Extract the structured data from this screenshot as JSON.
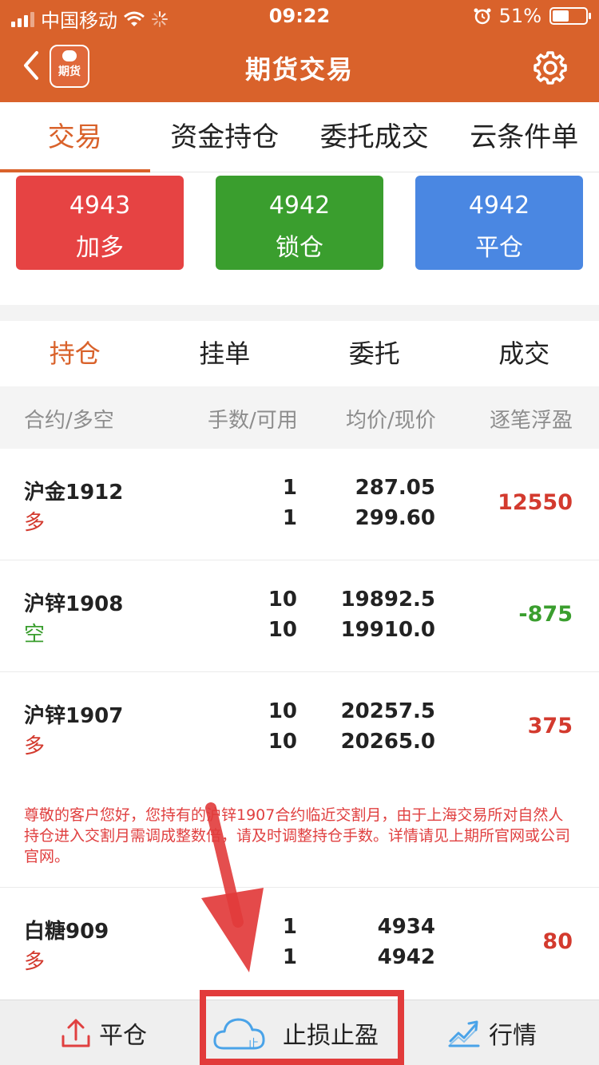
{
  "status_bar": {
    "carrier": "中国移动",
    "time": "09:22",
    "battery_text": "51%",
    "battery_level": 0.51
  },
  "nav": {
    "logo_text": "期货",
    "title": "期货交易"
  },
  "tabs": [
    {
      "label": "交易",
      "active": true
    },
    {
      "label": "资金持仓",
      "active": false
    },
    {
      "label": "委托成交",
      "active": false
    },
    {
      "label": "云条件单",
      "active": false
    }
  ],
  "actions": [
    {
      "price": "4943",
      "label": "加多",
      "color": "#e64343"
    },
    {
      "price": "4942",
      "label": "锁仓",
      "color": "#3a9e2e"
    },
    {
      "price": "4942",
      "label": "平仓",
      "color": "#4a87e2"
    }
  ],
  "subtabs": [
    {
      "label": "持仓",
      "active": true
    },
    {
      "label": "挂单",
      "active": false
    },
    {
      "label": "委托",
      "active": false
    },
    {
      "label": "成交",
      "active": false
    }
  ],
  "columns": [
    "合约/多空",
    "手数/可用",
    "均价/现价",
    "逐笔浮盈"
  ],
  "positions": [
    {
      "contract": "沪金1912",
      "direction": "多",
      "lots": "1",
      "available": "1",
      "avg_price": "287.05",
      "cur_price": "299.60",
      "pnl": "12550"
    },
    {
      "contract": "沪锌1908",
      "direction": "空",
      "lots": "10",
      "available": "10",
      "avg_price": "19892.5",
      "cur_price": "19910.0",
      "pnl": "-875"
    },
    {
      "contract": "沪锌1907",
      "direction": "多",
      "lots": "10",
      "available": "10",
      "avg_price": "20257.5",
      "cur_price": "20265.0",
      "pnl": "375"
    },
    {
      "contract": "白糖909",
      "direction": "多",
      "lots": "1",
      "available": "1",
      "avg_price": "4934",
      "cur_price": "4942",
      "pnl": "80"
    }
  ],
  "notice": "尊敬的客户您好，您持有的沪锌1907合约临近交割月，由于上海交易所对自然人持仓进入交割月需调成整数倍，请及时调整持仓手数。详情请见上期所官网或公司官网。",
  "bottom_bar": {
    "close_label": "平仓",
    "stop_label": "止损止盈",
    "stop_icon_text": "止",
    "market_label": "行情"
  },
  "colors": {
    "brand": "#d9622b",
    "long": "#d33a2e",
    "short": "#3a9e2e",
    "annotation": "#e23b3b"
  }
}
